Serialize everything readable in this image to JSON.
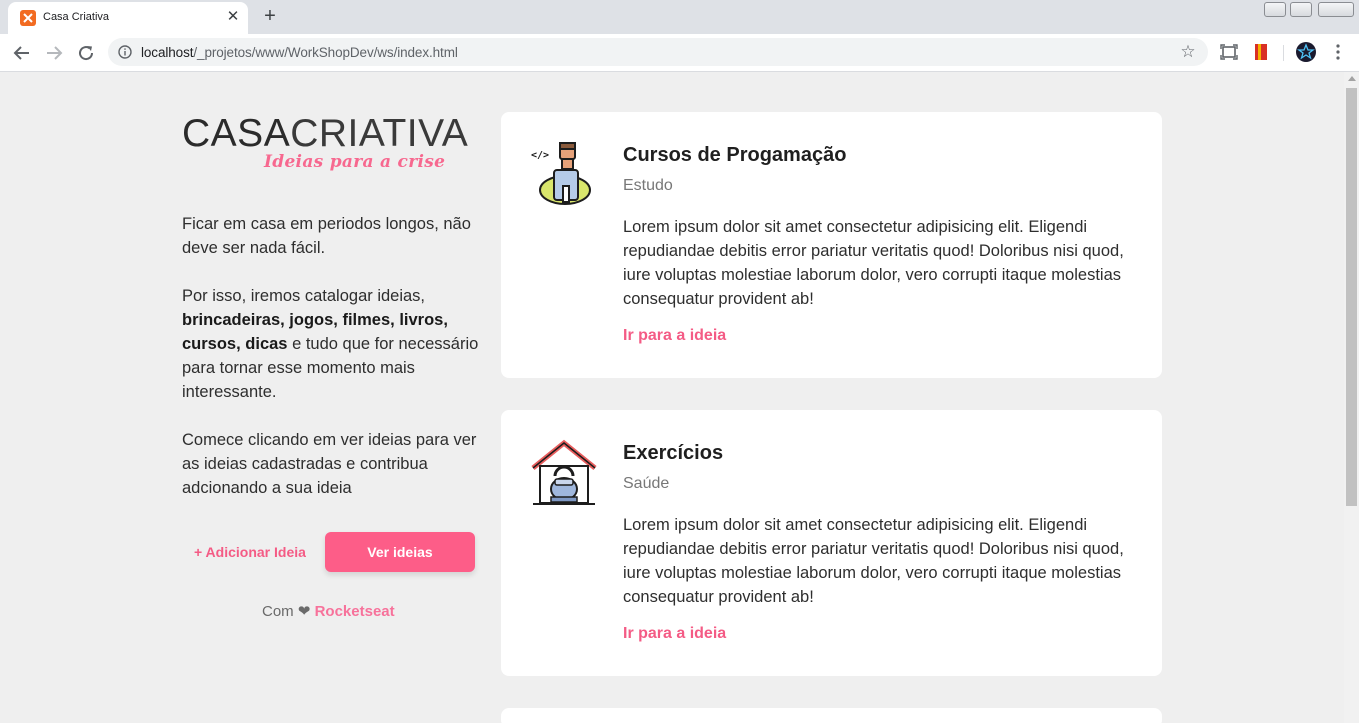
{
  "browser": {
    "tab_title": "Casa Criativa",
    "url_host": "localhost",
    "url_path": "/_projetos/www/WorkShopDev/ws/index.html",
    "favicon_color": "#f26b21"
  },
  "logo": {
    "bold": "CASA",
    "thin": "CRIATIVA",
    "tagline": "Ideias para a crise"
  },
  "intro": {
    "p1": "Ficar em casa em periodos longos, não deve ser nada fácil.",
    "p2_start": "Por isso, iremos catalogar ideias,",
    "p2_bold": "brincadeiras, jogos, filmes, livros, cursos, dicas",
    "p2_end": "e tudo que for necessário para tornar esse momento mais interessante.",
    "p3": "Comece clicando em ver ideias para ver as ideias cadastradas e contribua adcionando a sua ideia"
  },
  "actions": {
    "add_label": "+ Adicionar Ideia",
    "view_label": "Ver ideias"
  },
  "credit": {
    "prefix": "Com",
    "heart": "❤",
    "brand": "Rocketseat"
  },
  "ideas": [
    {
      "title": "Cursos de Progamação",
      "category": "Estudo",
      "description": "Lorem ipsum dolor sit amet consectetur adipisicing elit. Eligendi repudiandae debitis error pariatur veritatis quod! Doloribus nisi quod, iure voluptas molestiae laborum dolor, vero corrupti itaque molestias consequatur provident ab!",
      "link": "Ir para a ideia",
      "icon": "programmer-icon"
    },
    {
      "title": "Exercícios",
      "category": "Saúde",
      "description": "Lorem ipsum dolor sit amet consectetur adipisicing elit. Eligendi repudiandae debitis error pariatur veritatis quod! Doloribus nisi quod, iure voluptas molestiae laborum dolor, vero corrupti itaque molestias consequatur provident ab!",
      "link": "Ir para a ideia",
      "icon": "home-workout-icon"
    }
  ],
  "colors": {
    "accent": "#fd5d88",
    "link": "#f45b85",
    "background": "#efefef"
  }
}
